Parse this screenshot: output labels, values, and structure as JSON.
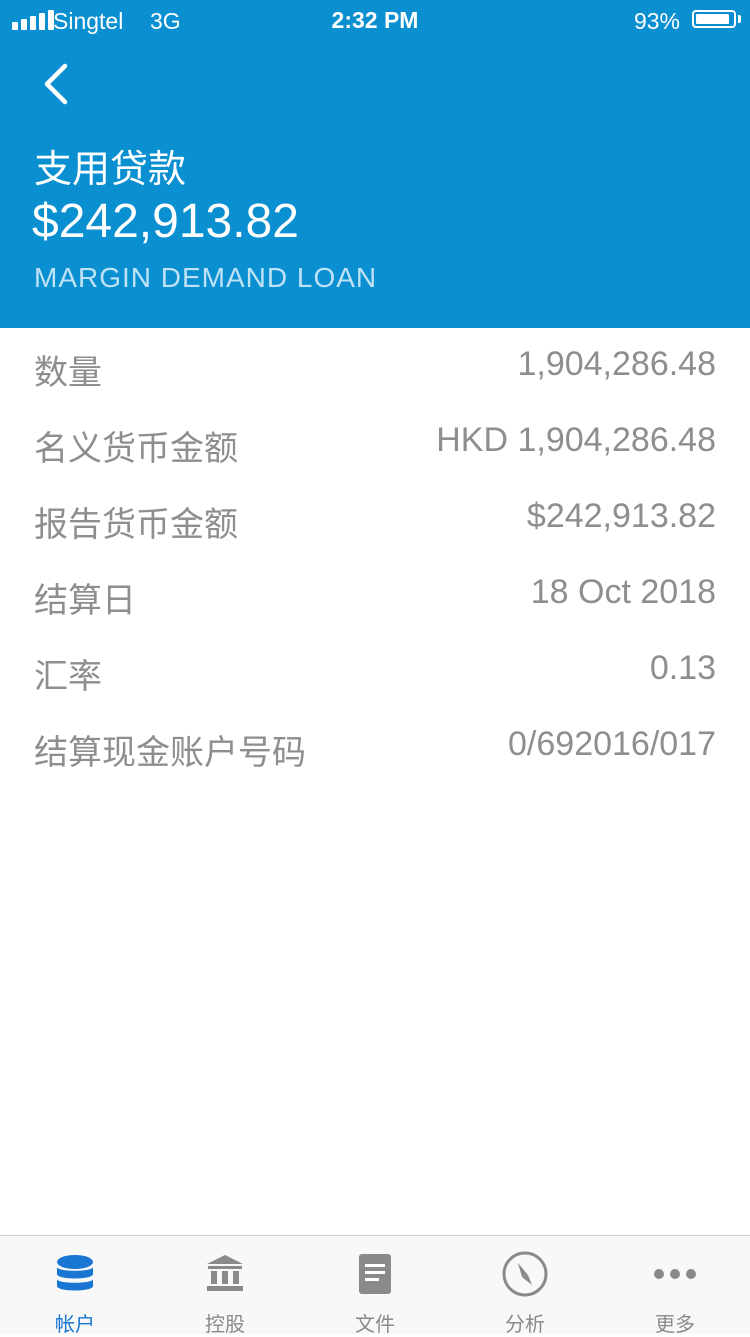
{
  "status_bar": {
    "carrier": "Singtel",
    "network": "3G",
    "time": "2:32 PM",
    "battery_percent_text": "93%",
    "battery_level": 0.93
  },
  "header": {
    "title": "支用贷款",
    "amount": "$242,913.82",
    "subtitle": "MARGIN DEMAND LOAN",
    "background_color": "#0a8fd1"
  },
  "details": [
    {
      "label": "数量",
      "value": "1,904,286.48"
    },
    {
      "label": "名义货币金额",
      "value": "HKD 1,904,286.48"
    },
    {
      "label": "报告货币金额",
      "value": "$242,913.82"
    },
    {
      "label": "结算日",
      "value": "18 Oct 2018"
    },
    {
      "label": "汇率",
      "value": "0.13"
    },
    {
      "label": "结算现金账户号码",
      "value": "0/692016/017"
    }
  ],
  "tabs": [
    {
      "label": "帐户",
      "icon": "database-icon",
      "active": true
    },
    {
      "label": "控股",
      "icon": "bank-icon",
      "active": false
    },
    {
      "label": "文件",
      "icon": "document-icon",
      "active": false
    },
    {
      "label": "分析",
      "icon": "compass-icon",
      "active": false
    },
    {
      "label": "更多",
      "icon": "more-dots-icon",
      "active": false
    }
  ],
  "colors": {
    "accent": "#1976d2",
    "inactive": "#8a8a8a"
  }
}
